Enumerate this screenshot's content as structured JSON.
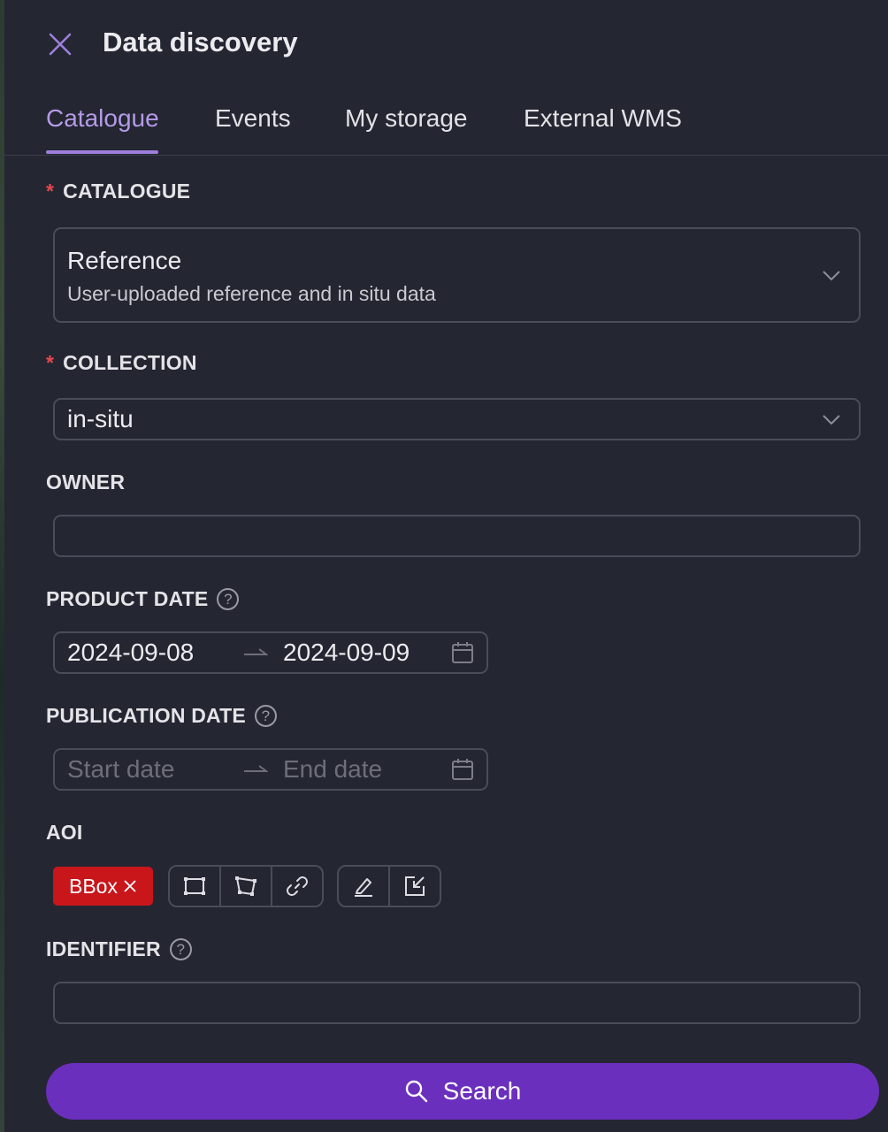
{
  "header": {
    "title": "Data discovery",
    "close_icon": "close-icon"
  },
  "tabs": [
    {
      "label": "Catalogue",
      "active": true
    },
    {
      "label": "Events",
      "active": false
    },
    {
      "label": "My storage",
      "active": false
    },
    {
      "label": "External WMS",
      "active": false
    }
  ],
  "catalogue": {
    "label": "CATALOGUE",
    "required_mark": "*",
    "value": "Reference",
    "description": "User-uploaded reference and in situ data"
  },
  "collection": {
    "label": "COLLECTION",
    "required_mark": "*",
    "value": "in-situ"
  },
  "owner": {
    "label": "OWNER",
    "value": ""
  },
  "product_date": {
    "label": "PRODUCT DATE",
    "help": "?",
    "start": "2024-09-08",
    "end": "2024-09-09"
  },
  "publication_date": {
    "label": "PUBLICATION DATE",
    "help": "?",
    "start_placeholder": "Start date",
    "end_placeholder": "End date"
  },
  "aoi": {
    "label": "AOI",
    "chip_label": "BBox",
    "chip_color": "#c8161b",
    "tools": [
      "rectangle-icon",
      "polygon-icon",
      "link-icon"
    ],
    "edit_tools": [
      "edit-icon",
      "import-icon"
    ]
  },
  "identifier": {
    "label": "IDENTIFIER",
    "help": "?",
    "value": ""
  },
  "search": {
    "label": "Search",
    "color": "#6b2fbd"
  },
  "colors": {
    "accent": "#9c7fdc",
    "required": "#e5484d",
    "background": "#242632"
  }
}
